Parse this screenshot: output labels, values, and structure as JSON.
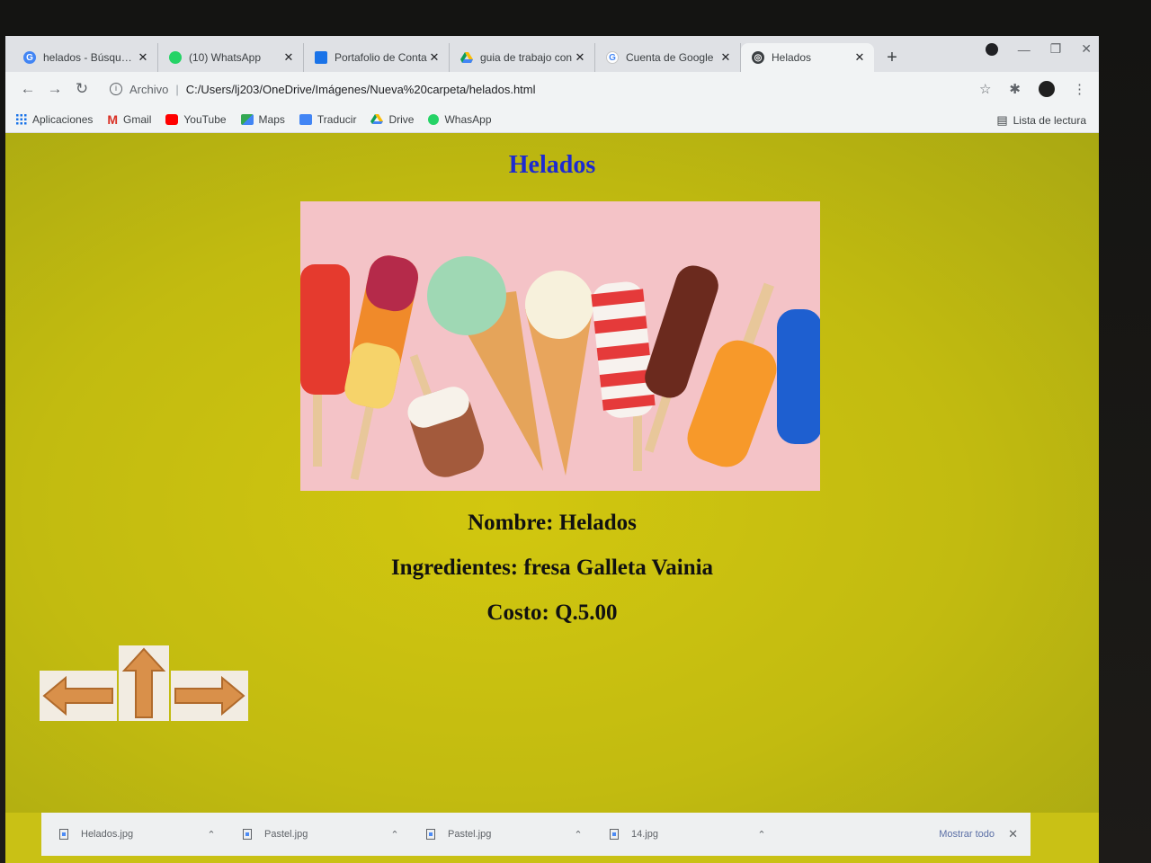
{
  "tabs": [
    {
      "label": "helados - Búsqueda",
      "icon": "google-icon",
      "color": "#4285f4"
    },
    {
      "label": "(10) WhatsApp",
      "icon": "whatsapp-icon",
      "color": "#25d366"
    },
    {
      "label": "Portafolio de Conta",
      "icon": "classroom-icon",
      "color": "#1a73e8"
    },
    {
      "label": "guia de trabajo con",
      "icon": "drive-icon",
      "color": "#0f9d58"
    },
    {
      "label": "Cuenta de Google",
      "icon": "google-icon",
      "color": "#4285f4"
    },
    {
      "label": "Helados",
      "icon": "globe-icon",
      "color": "#3c4043",
      "active": true
    }
  ],
  "toolbar": {
    "scheme": "Archivo",
    "url": "C:/Users/lj203/OneDrive/Imágenes/Nueva%20carpeta/helados.html"
  },
  "bookmarks": [
    {
      "label": "Aplicaciones",
      "icon": "apps-grid-icon",
      "color": "#1a73e8"
    },
    {
      "label": "Gmail",
      "icon": "gmail-icon",
      "color": "#d93025"
    },
    {
      "label": "YouTube",
      "icon": "youtube-icon",
      "color": "#ff0000"
    },
    {
      "label": "Maps",
      "icon": "maps-icon",
      "color": "#34a853"
    },
    {
      "label": "Traducir",
      "icon": "translate-icon",
      "color": "#4285f4"
    },
    {
      "label": "Drive",
      "icon": "drive-icon",
      "color": "#fbbc04"
    },
    {
      "label": "WhasApp",
      "icon": "whatsapp-icon",
      "color": "#25d366"
    }
  ],
  "reading_list": "Lista de lectura",
  "page": {
    "title": "Helados",
    "nombre": "Nombre: Helados",
    "ingredientes": "Ingredientes: fresa Galleta Vainia",
    "costo": "Costo: Q.5.00",
    "title_color": "#1d2ad0",
    "background": "#c9c115"
  },
  "downloads": {
    "items": [
      "Helados.jpg",
      "Pastel.jpg",
      "Pastel.jpg",
      "14.jpg"
    ],
    "show_all": "Mostrar todo"
  }
}
